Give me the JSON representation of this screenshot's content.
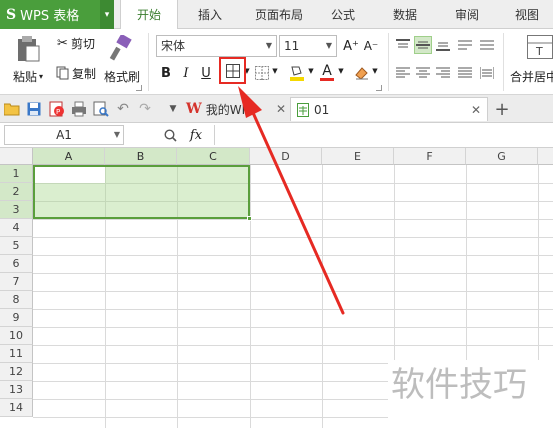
{
  "app": {
    "logo": "S",
    "name": "WPS 表格",
    "caret": "▾"
  },
  "ribbon_tabs": [
    "开始",
    "插入",
    "页面布局",
    "公式",
    "数据",
    "审阅",
    "视图"
  ],
  "clipboard": {
    "paste": "粘贴",
    "cut": "剪切",
    "copy": "复制",
    "format_painter": "格式刷"
  },
  "font": {
    "name": "宋体",
    "size": "11",
    "bold": "B",
    "italic": "I",
    "underline": "U",
    "grow": "A⁺",
    "shrink": "A⁻",
    "font_color_letter": "A"
  },
  "merge": {
    "label": "合并居中"
  },
  "doc_tabs": [
    {
      "label": "我的WPS"
    },
    {
      "label": "01"
    }
  ],
  "formula": {
    "name_box": "A1",
    "fx": "fx"
  },
  "columns": [
    "A",
    "B",
    "C",
    "D",
    "E",
    "F",
    "G"
  ],
  "rows": [
    "1",
    "2",
    "3",
    "4",
    "5",
    "6",
    "7",
    "8",
    "9",
    "10",
    "11",
    "12",
    "13",
    "14"
  ],
  "watermark": "软件技巧",
  "colors": {
    "accent": "#4a9e3c",
    "highlight": "#e62a23",
    "selection": "#a8d68c"
  }
}
